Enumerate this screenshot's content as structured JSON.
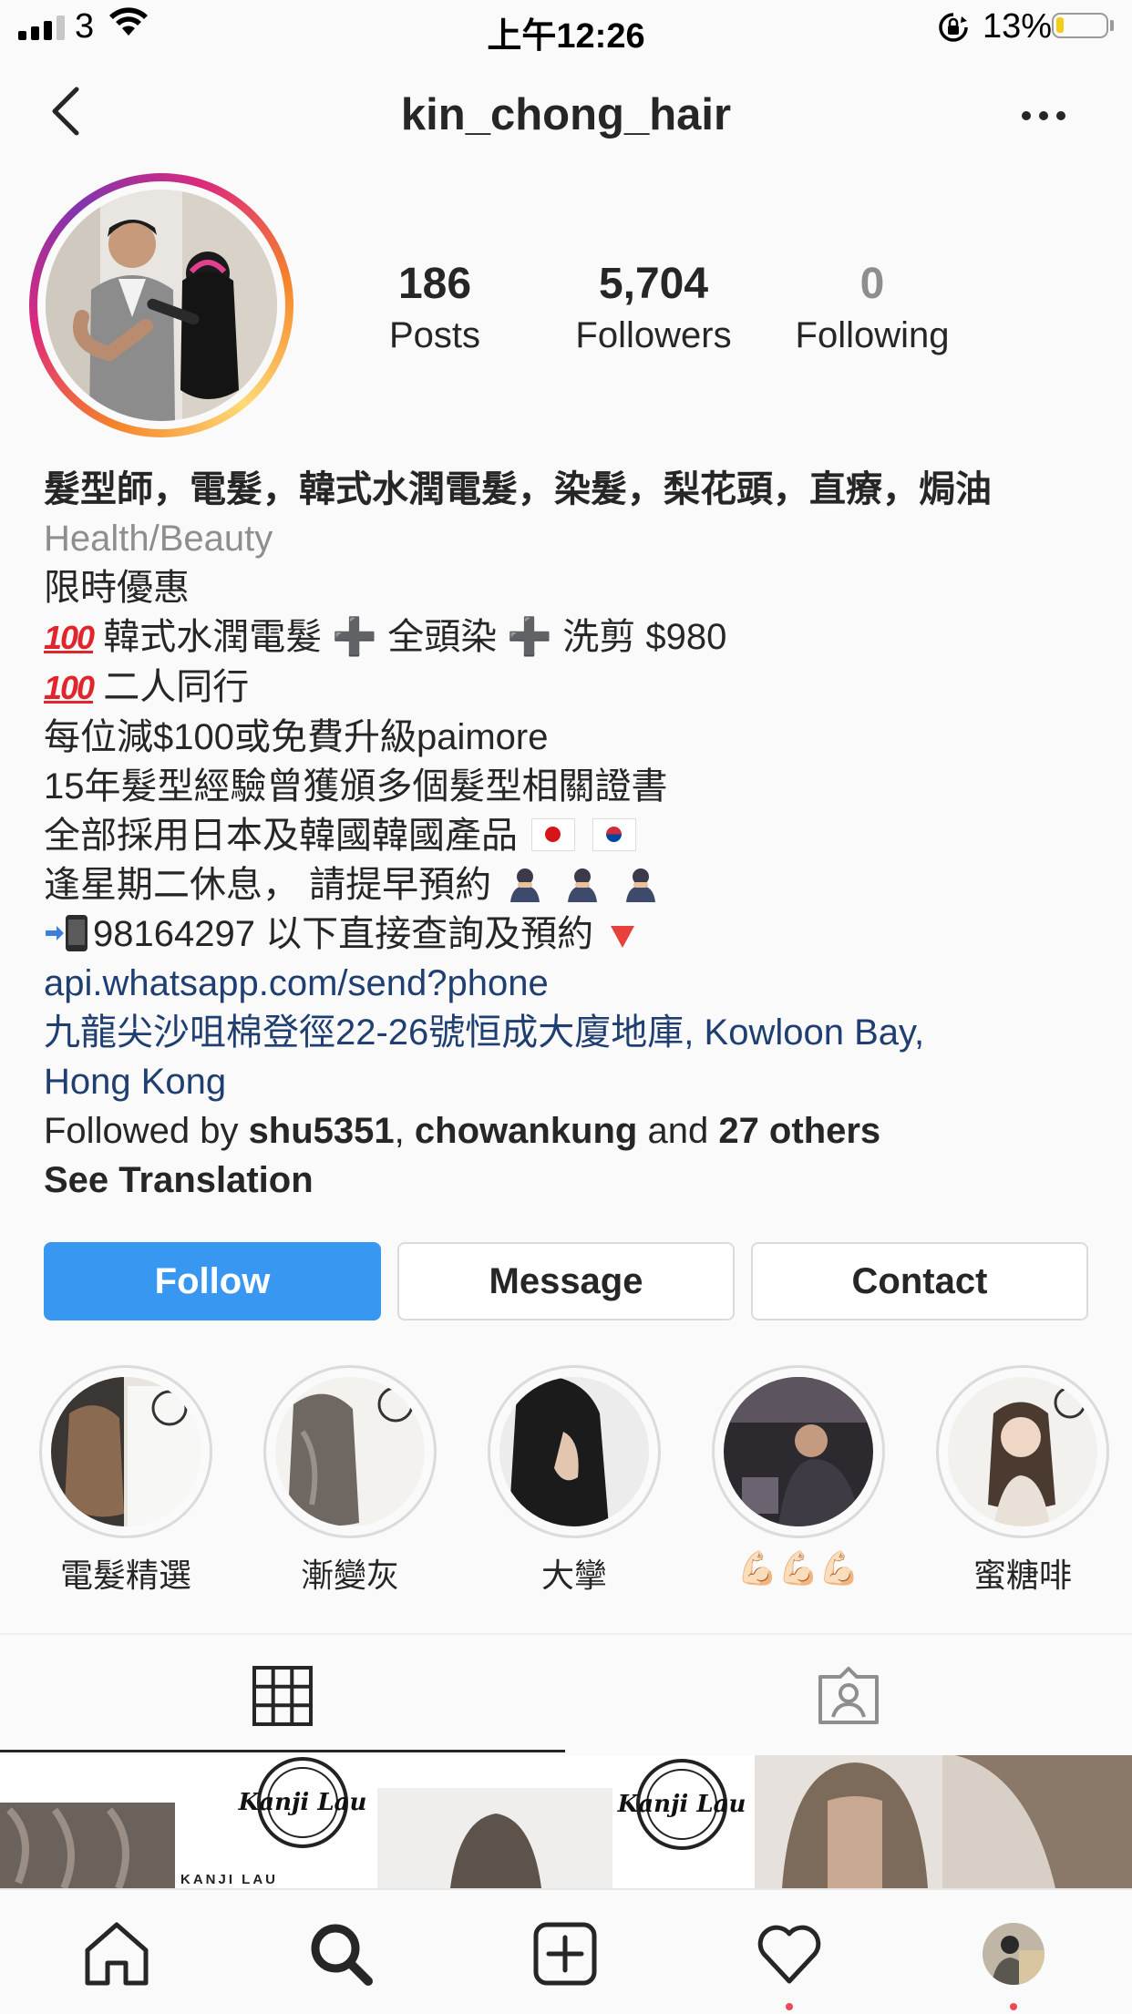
{
  "status_bar": {
    "carrier": "3",
    "time": "上午12:26",
    "battery_pct": "13%",
    "icons": [
      "signal-icon",
      "wifi-icon",
      "rotation-lock-icon",
      "battery-icon"
    ]
  },
  "header": {
    "username": "kin_chong_hair",
    "icons": [
      "back-icon",
      "more-icon"
    ]
  },
  "stats": {
    "posts": {
      "value": "186",
      "label": "Posts"
    },
    "followers": {
      "value": "5,704",
      "label": "Followers"
    },
    "following": {
      "value": "0",
      "label": "Following"
    }
  },
  "bio": {
    "name": "髮型師，電髮，韓式水潤電髮，染髮，梨花頭，直療，焗油",
    "category": "Health/Beauty",
    "line1": "限時優惠",
    "line2": "韓式水潤電髮 ➕ 全頭染 ➕ 洗剪 $980",
    "line3": "二人同行",
    "line4": "每位減$100或免費升級paimore",
    "line5": "15年髮型經驗曾獲頒多個髮型相關證書",
    "line6": "全部採用日本及韓國韓國產品",
    "line7": "逢星期二休息，  請提早預約",
    "line8": "98164297 以下直接查詢及預約",
    "website": "api.whatsapp.com/send?phone",
    "address_line1": "九龍尖沙咀棉登徑22-26號恒成大廈地庫, Kowloon Bay,",
    "address_line2": "Hong Kong",
    "followed_by_prefix": "Followed by ",
    "followed_user1": "shu5351",
    "followed_sep": ", ",
    "followed_user2": "chowankung",
    "followed_and": " and ",
    "followed_others": "27 others",
    "see_translation": "See Translation"
  },
  "buttons": {
    "follow": "Follow",
    "message": "Message",
    "contact": "Contact"
  },
  "highlights": [
    {
      "label": "電髮精選"
    },
    {
      "label": "漸變灰"
    },
    {
      "label": "大攣"
    },
    {
      "label": "💪🏻💪🏻💪🏻"
    },
    {
      "label": "蜜糖啡"
    }
  ],
  "grid_text": {
    "brand": "KANJI LAU"
  },
  "colors": {
    "follow_button": "#3897f0",
    "link": "#1f3f73",
    "muted": "#8e8e8e",
    "notification_dot": "#ed4956"
  },
  "bottom_nav": [
    "home-icon",
    "search-icon",
    "new-post-icon",
    "activity-heart-icon",
    "profile-avatar"
  ]
}
